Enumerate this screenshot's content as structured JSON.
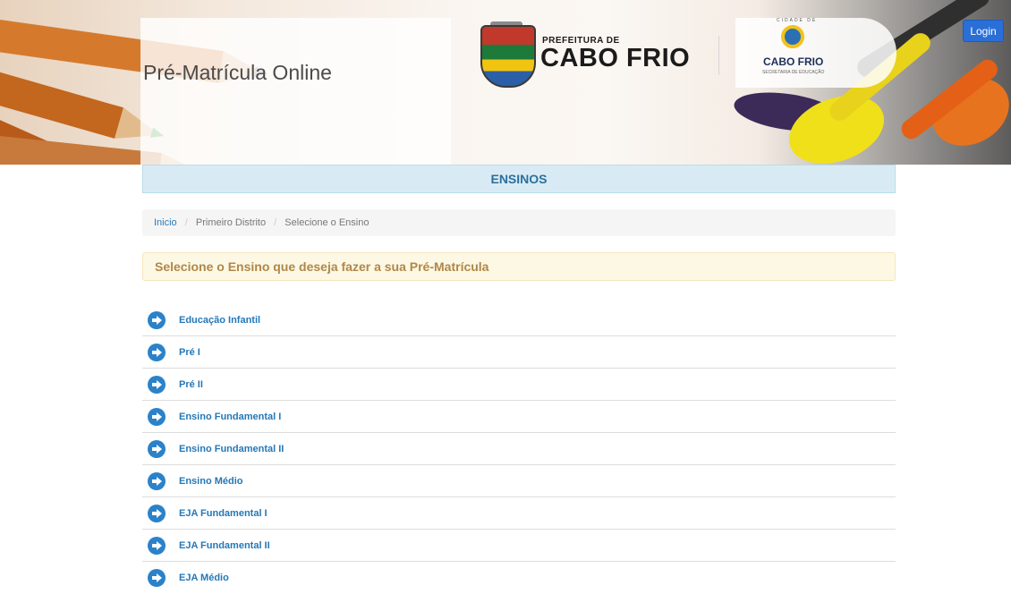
{
  "header": {
    "site_title": "Pré-Matrícula Online",
    "prefeitura_small": "PREFEITURA DE",
    "prefeitura_big": "CABO FRIO",
    "logo2_small": "CIDADE DE",
    "logo2_big": "CABO FRIO",
    "logo2_sub": "SECRETARIA DE EDUCAÇÃO",
    "login_label": "Login"
  },
  "main": {
    "heading": "ENSINOS",
    "breadcrumb": [
      "Inicio",
      "Primeiro Distrito",
      "Selecione o Ensino"
    ],
    "alert": "Selecione o Ensino que deseja fazer a sua Pré-Matrícula",
    "options": [
      "Educação Infantil",
      "Pré I",
      "Pré II",
      "Ensino Fundamental I",
      "Ensino Fundamental II",
      "Ensino Médio",
      "EJA Fundamental I",
      "EJA Fundamental II",
      "EJA Médio"
    ]
  },
  "colors": {
    "login_button": "#2a6fd6",
    "heading_bg": "#d8ebf5",
    "alert_bg": "#fcf8e3",
    "link": "#2478b8",
    "arrow_icon": "#2b82c9"
  },
  "icons": {
    "option_icon": "arrow-right-circle-icon"
  }
}
